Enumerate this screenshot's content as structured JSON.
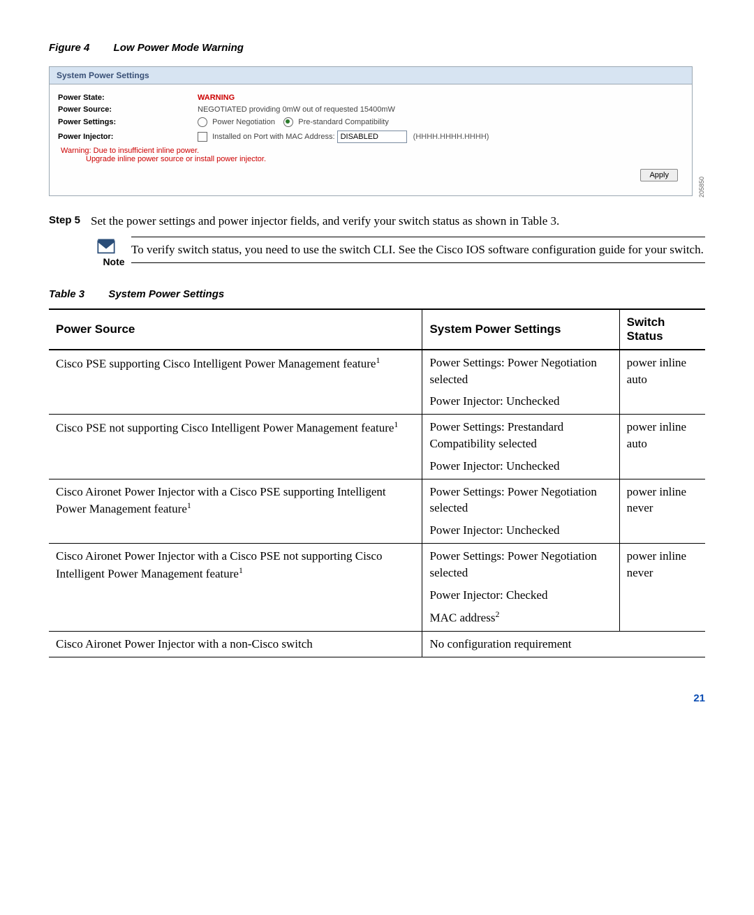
{
  "figure": {
    "label": "Figure 4",
    "title": "Low Power Mode Warning"
  },
  "panel": {
    "header": "System Power Settings",
    "rows": {
      "state_label": "Power State:",
      "state_value": "WARNING",
      "source_label": "Power Source:",
      "source_value": "NEGOTIATED providing 0mW out of requested 15400mW",
      "settings_label": "Power Settings:",
      "radio1": "Power Negotiation",
      "radio2": "Pre-standard Compatibility",
      "injector_label": "Power Injector:",
      "injector_check_label": "Installed on Port with MAC Address:",
      "injector_value": "DISABLED",
      "injector_hint": "(HHHH.HHHH.HHHH)"
    },
    "warning1": "Warning: Due to insufficient inline power.",
    "warning2": "Upgrade inline power source or install power injector.",
    "apply": "Apply",
    "imgnum": "205850"
  },
  "step": {
    "label": "Step 5",
    "text": "Set the power settings and power injector fields, and verify your switch status as shown in Table 3."
  },
  "note": {
    "label": "Note",
    "text": "To verify switch status, you need to use the switch CLI. See the Cisco IOS software configuration guide for your switch."
  },
  "table": {
    "label": "Table 3",
    "title": "System Power Settings",
    "headers": [
      "Power Source",
      "System Power Settings",
      "Switch Status"
    ],
    "rows": [
      {
        "c1": "Cisco PSE supporting Cisco Intelligent Power Management feature",
        "c1sup": "1",
        "c2a": "Power Settings: Power Negotiation selected",
        "c2b": "Power Injector: Unchecked",
        "c3": "power inline auto"
      },
      {
        "c1": "Cisco PSE not supporting Cisco Intelligent Power Management feature",
        "c1sup": "1",
        "c2a": "Power Settings: Prestandard Compatibility selected",
        "c2b": "Power Injector: Unchecked",
        "c3": "power inline auto"
      },
      {
        "c1": "Cisco Aironet Power Injector with a Cisco PSE supporting Intelligent Power Management feature",
        "c1sup": "1",
        "c2a": "Power Settings: Power Negotiation selected",
        "c2b": "Power Injector: Unchecked",
        "c3": "power inline never"
      },
      {
        "c1": "Cisco Aironet Power Injector with a Cisco PSE not supporting Cisco Intelligent Power Management feature",
        "c1sup": "1",
        "c2a": "Power Settings: Power Negotiation selected",
        "c2b": "Power Injector: Checked",
        "c2c": "MAC address",
        "c2csup": "2",
        "c3": "power inline never"
      },
      {
        "c1": "Cisco Aironet Power Injector with a non-Cisco switch",
        "c1sup": "",
        "c2a": "No configuration requirement",
        "c3": ""
      }
    ]
  },
  "pagenum": "21"
}
